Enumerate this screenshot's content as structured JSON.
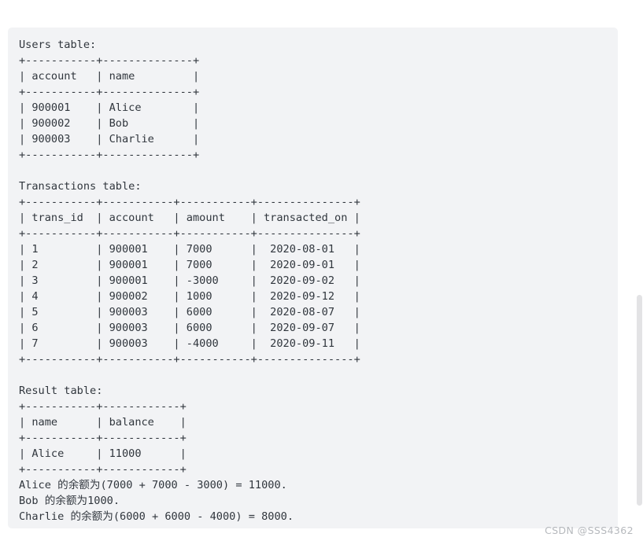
{
  "page": {
    "background_color": "#ffffff",
    "code_block_background": "#f2f3f5",
    "text_color": "#30363d"
  },
  "watermark": {
    "text": "CSDN @SSS4362",
    "color": "#b6b9bd"
  },
  "scrollbar": {
    "thumb_color": "#e3e3e5"
  },
  "code_block": {
    "language": "text",
    "lines": [
      "Users table:",
      "+-----------+--------------+",
      "| account   | name         |",
      "+-----------+--------------+",
      "| 900001    | Alice        |",
      "| 900002    | Bob          |",
      "| 900003    | Charlie      |",
      "+-----------+--------------+",
      "",
      "Transactions table:",
      "+-----------+-----------+-----------+---------------+",
      "| trans_id  | account   | amount    | transacted_on |",
      "+-----------+-----------+-----------+---------------+",
      "| 1         | 900001    | 7000      |  2020-08-01   |",
      "| 2         | 900001    | 7000      |  2020-09-01   |",
      "| 3         | 900001    | -3000     |  2020-09-02   |",
      "| 4         | 900002    | 1000      |  2020-09-12   |",
      "| 5         | 900003    | 6000      |  2020-08-07   |",
      "| 6         | 900003    | 6000      |  2020-09-07   |",
      "| 7         | 900003    | -4000     |  2020-09-11   |",
      "+-----------+-----------+-----------+---------------+",
      "",
      "Result table:",
      "+-----------+------------+",
      "| name      | balance    |",
      "+-----------+------------+",
      "| Alice     | 11000      |",
      "+-----------+------------+",
      "Alice 的余额为(7000 + 7000 - 3000) = 11000.",
      "Bob 的余额为1000.",
      "Charlie 的余额为(6000 + 6000 - 4000) = 8000."
    ],
    "tables": {
      "users": {
        "title": "Users table:",
        "columns": [
          "account",
          "name"
        ],
        "rows": [
          [
            "900001",
            "Alice"
          ],
          [
            "900002",
            "Bob"
          ],
          [
            "900003",
            "Charlie"
          ]
        ]
      },
      "transactions": {
        "title": "Transactions table:",
        "columns": [
          "trans_id",
          "account",
          "amount",
          "transacted_on"
        ],
        "rows": [
          [
            "1",
            "900001",
            "7000",
            "2020-08-01"
          ],
          [
            "2",
            "900001",
            "7000",
            "2020-09-01"
          ],
          [
            "3",
            "900001",
            "-3000",
            "2020-09-02"
          ],
          [
            "4",
            "900002",
            "1000",
            "2020-09-12"
          ],
          [
            "5",
            "900003",
            "6000",
            "2020-08-07"
          ],
          [
            "6",
            "900003",
            "6000",
            "2020-09-07"
          ],
          [
            "7",
            "900003",
            "-4000",
            "2020-09-11"
          ]
        ]
      },
      "result": {
        "title": "Result table:",
        "columns": [
          "name",
          "balance"
        ],
        "rows": [
          [
            "Alice",
            "11000"
          ]
        ]
      }
    },
    "explanations": [
      "Alice 的余额为(7000 + 7000 - 3000) = 11000.",
      "Bob 的余额为1000.",
      "Charlie 的余额为(6000 + 6000 - 4000) = 8000."
    ]
  }
}
